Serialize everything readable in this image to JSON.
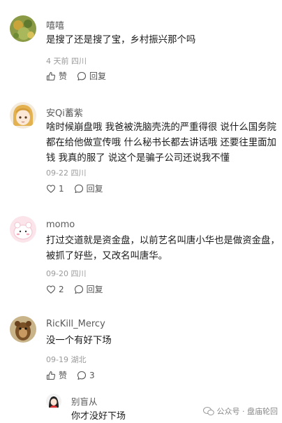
{
  "comments": [
    {
      "user": "嘻嘻",
      "text": "是搜了还是搜了宝，乡村振兴那个吗",
      "meta": "4 天前 四川",
      "like_label": "赞",
      "reply_label": "回复"
    },
    {
      "user": "安Qi蓄紫",
      "text": "啥时候崩盘哦 我爸被洗脑壳洗的严重得很 说什么国务院都在给他做宣传哦 什么秘书长都去讲话哦 还要往里面加钱 我真的服了 说这个是骗子公司还说我不懂",
      "meta": "09-22 四川",
      "like_count": "1",
      "reply_label": "回复"
    },
    {
      "user": "momo",
      "text": "打过交道就是资金盘，以前艺名叫唐小华也是做资金盘，被抓了好些，又改名叫唐华。",
      "meta": "09-20 四川",
      "like_count": "2",
      "reply_label": "回复"
    },
    {
      "user": "RicKill_Mercy",
      "text": "没一个有好下场",
      "meta": "09-19 湖北",
      "like_label": "赞",
      "reply_count": "3"
    }
  ],
  "reply": {
    "user": "别盲从",
    "text": "你才没好下场"
  },
  "watermark": {
    "text": "公众号 · 盘庙轮回"
  }
}
